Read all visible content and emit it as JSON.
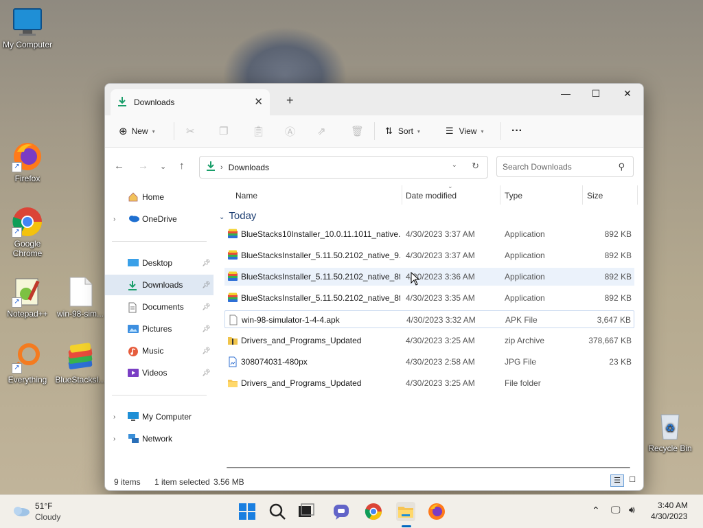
{
  "desktop": {
    "icons": [
      {
        "label": "My Computer"
      },
      {
        "label": "Firefox"
      },
      {
        "label": "Google Chrome"
      },
      {
        "label": "Notepad++"
      },
      {
        "label": "win-98-sim..."
      },
      {
        "label": "Everything"
      },
      {
        "label": "BlueStacksI..."
      },
      {
        "label": "Recycle Bin"
      }
    ]
  },
  "window": {
    "tab_title": "Downloads",
    "toolbar": {
      "new_label": "New",
      "sort_label": "Sort",
      "view_label": "View",
      "more_label": "···"
    },
    "address": {
      "path": "Downloads"
    },
    "search": {
      "placeholder": "Search Downloads"
    },
    "sidebar": {
      "items": [
        {
          "label": "Home"
        },
        {
          "label": "OneDrive"
        },
        {
          "label": "Desktop"
        },
        {
          "label": "Downloads"
        },
        {
          "label": "Documents"
        },
        {
          "label": "Pictures"
        },
        {
          "label": "Music"
        },
        {
          "label": "Videos"
        },
        {
          "label": "My Computer"
        },
        {
          "label": "Network"
        }
      ]
    },
    "columns": {
      "name": "Name",
      "date": "Date modified",
      "type": "Type",
      "size": "Size"
    },
    "group_label": "Today",
    "files": [
      {
        "name": "BlueStacks10Installer_10.0.11.1011_native...",
        "date": "4/30/2023 3:37 AM",
        "type": "Application",
        "size": "892 KB",
        "icon": "bluestacks-icon"
      },
      {
        "name": "BlueStacksInstaller_5.11.50.2102_native_9...",
        "date": "4/30/2023 3:37 AM",
        "type": "Application",
        "size": "892 KB",
        "icon": "bluestacks-icon"
      },
      {
        "name": "BlueStacksInstaller_5.11.50.2102_native_8f...",
        "date": "4/30/2023 3:36 AM",
        "type": "Application",
        "size": "892 KB",
        "icon": "bluestacks-icon"
      },
      {
        "name": "BlueStacksInstaller_5.11.50.2102_native_8f...",
        "date": "4/30/2023 3:35 AM",
        "type": "Application",
        "size": "892 KB",
        "icon": "bluestacks-icon"
      },
      {
        "name": "win-98-simulator-1-4-4.apk",
        "date": "4/30/2023 3:32 AM",
        "type": "APK File",
        "size": "3,647 KB",
        "icon": "file-icon"
      },
      {
        "name": "Drivers_and_Programs_Updated",
        "date": "4/30/2023 3:25 AM",
        "type": "zip Archive",
        "size": "378,667 KB",
        "icon": "zip-icon"
      },
      {
        "name": "308074031-480px",
        "date": "4/30/2023 2:58 AM",
        "type": "JPG File",
        "size": "23 KB",
        "icon": "image-icon"
      },
      {
        "name": "Drivers_and_Programs_Updated",
        "date": "4/30/2023 3:25 AM",
        "type": "File folder",
        "size": "",
        "icon": "folder-icon"
      }
    ],
    "status": {
      "item_count": "9 items",
      "selection": "1 item selected",
      "selection_size": "3.56 MB"
    }
  },
  "taskbar": {
    "weather_temp": "51°F",
    "weather_desc": "Cloudy",
    "clock_time": "3:40 AM",
    "clock_date": "4/30/2023"
  },
  "colors": {
    "accent": "#0067c0",
    "selected_bg": "#dfe8f3",
    "hover_bg": "#ebf2fb"
  }
}
